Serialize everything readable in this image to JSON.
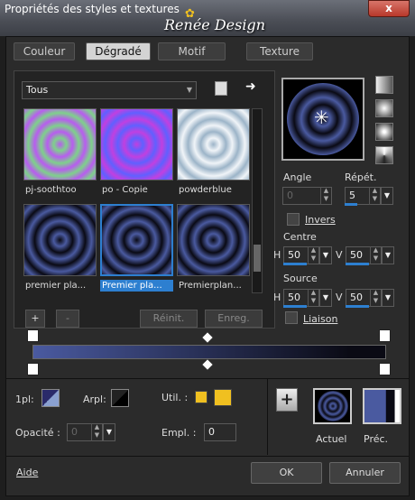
{
  "window": {
    "title": "Propriétés des styles et textures",
    "brand": "Renée Design",
    "close": "x"
  },
  "tabs": [
    "Couleur",
    "Dégradé",
    "Motif",
    "Texture"
  ],
  "dropdown": {
    "value": "Tous"
  },
  "gradients": [
    {
      "name": "pj-soothtoo",
      "colors": [
        "#7ed18a",
        "#b85cf0"
      ]
    },
    {
      "name": "po - Copie",
      "colors": [
        "#6060ff",
        "#c040e0"
      ]
    },
    {
      "name": "powderblue",
      "colors": [
        "#f0f4f8",
        "#9cb4c8"
      ]
    },
    {
      "name": "premier pla...",
      "colors": [
        "#4a5aa0",
        "#0a0a14"
      ]
    },
    {
      "name": "Premier pla...",
      "colors": [
        "#4a5aa0",
        "#0a0a14"
      ]
    },
    {
      "name": "Premierplan...",
      "colors": [
        "#4a5aa0",
        "#0a0a14"
      ]
    }
  ],
  "buttons": {
    "add": "+",
    "remove": "-",
    "reinit": "Réinit.",
    "save": "Enreg."
  },
  "params": {
    "angle_label": "Angle",
    "angle": "0",
    "repeat_label": "Répét.",
    "repeat": "5",
    "invert": "Invers",
    "centre_label": "Centre",
    "centre_h": "50",
    "centre_v": "50",
    "source_label": "Source",
    "source_h": "50",
    "source_v": "50",
    "link": "Liaison",
    "h": "H",
    "v": "V"
  },
  "bottom": {
    "fg_label": "1pl:",
    "bg_label": "Arpl:",
    "util_label": "Util. :",
    "opacity_label": "Opacité :",
    "opacity": "0",
    "position_label": "Empl. :",
    "position": "0",
    "current": "Actuel",
    "prev": "Préc.",
    "help": "Aide",
    "ok": "OK",
    "cancel": "Annuler"
  },
  "colors": {
    "accent": "#2d7fd0",
    "gold": "#f0c020",
    "ring_blue": "#4a5aa0"
  }
}
